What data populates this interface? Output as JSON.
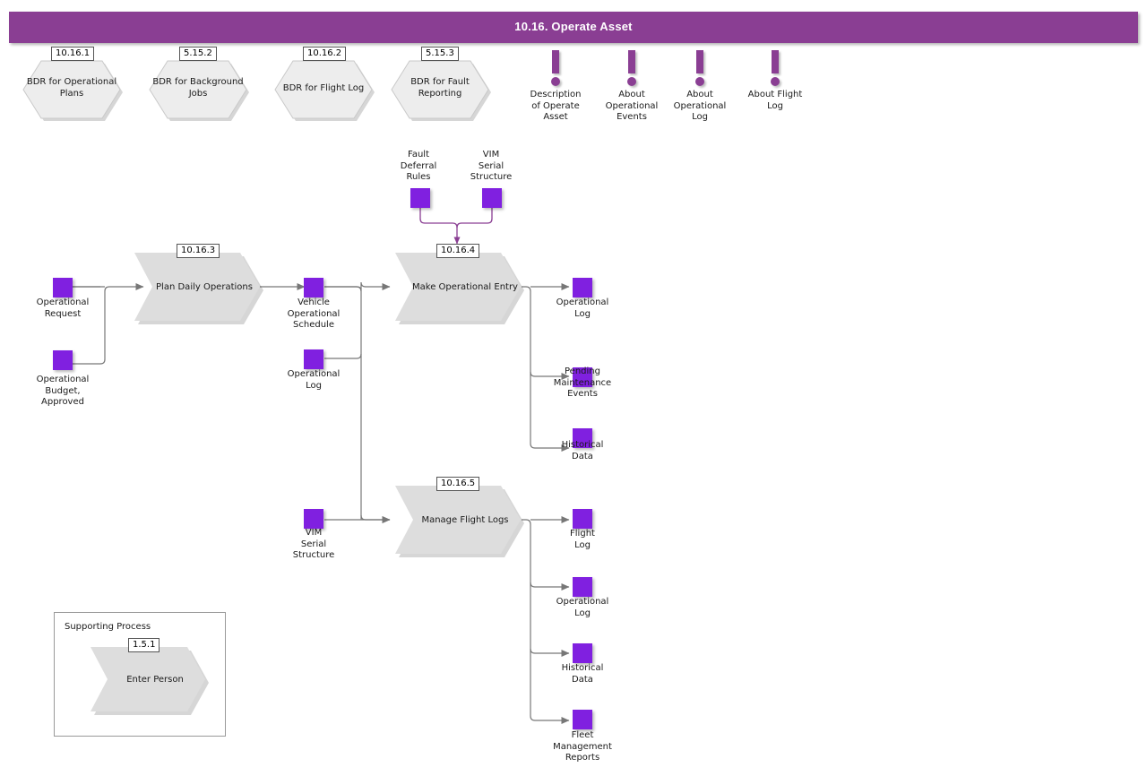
{
  "header": {
    "title": "10.16. Operate Asset",
    "bar_color": "#8A3E93",
    "text_color": "#FFFFFF"
  },
  "palette": {
    "process_fill": "#DDDDDD",
    "bdr_fill": "#EDEDED",
    "data_square": "#8020E0",
    "info_marker": "#8A3E93",
    "connector": "#777777",
    "connector_purple": "#8A3E93"
  },
  "bdr_nodes": [
    {
      "id": "10.16.1",
      "label": "BDR for\nOperational\nPlans"
    },
    {
      "id": "5.15.2",
      "label": "BDR for\nBackground\nJobs"
    },
    {
      "id": "10.16.2",
      "label": "BDR for\nFlight Log"
    },
    {
      "id": "5.15.3",
      "label": "BDR for\nFault\nReporting"
    }
  ],
  "info_nodes": [
    {
      "label": "Description\nof Operate\nAsset"
    },
    {
      "label": "About\nOperational\nEvents"
    },
    {
      "label": "About\nOperational\nLog"
    },
    {
      "label": "About Flight\nLog"
    }
  ],
  "processes": [
    {
      "id": "10.16.3",
      "label": "Plan Daily\nOperations"
    },
    {
      "id": "10.16.4",
      "label": "Make\nOperational\nEntry"
    },
    {
      "id": "10.16.5",
      "label": "Manage\nFlight Logs"
    }
  ],
  "inputs_plan": [
    {
      "label": "Operational\nRequest"
    },
    {
      "label": "Operational\nBudget,\nApproved"
    }
  ],
  "middle_data": [
    {
      "label": "Vehicle\nOperational\nSchedule"
    },
    {
      "label": "Operational\nLog"
    },
    {
      "label": "VIM\nSerial\nStructure"
    }
  ],
  "entry_control_data": [
    {
      "label": "Fault\nDeferral\nRules"
    },
    {
      "label": "VIM\nSerial\nStructure"
    }
  ],
  "outputs_entry": [
    {
      "label": "Operational\nLog"
    },
    {
      "label": "Pending\nMaintenance\nEvents"
    },
    {
      "label": "Historical\nData"
    }
  ],
  "outputs_flightlogs": [
    {
      "label": "Flight\nLog"
    },
    {
      "label": "Operational\nLog"
    },
    {
      "label": "Historical\nData"
    },
    {
      "label": "Fleet\nManagement\nReports"
    }
  ],
  "supporting_process": {
    "title": "Supporting Process",
    "id": "1.5.1",
    "label": "Enter Person"
  }
}
